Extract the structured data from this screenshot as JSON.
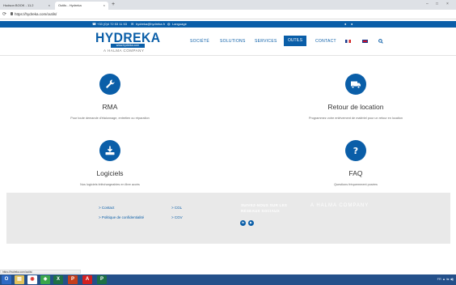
{
  "browser": {
    "tabs": [
      {
        "label": "Hudson BOOK - 11.2",
        "close": "×"
      },
      {
        "label": "Outils - Hydreka",
        "close": "×"
      }
    ],
    "new_tab": "+",
    "window_controls": [
      "–",
      "□",
      "×"
    ],
    "url": "https://hydreka.com/outils/"
  },
  "topbar": {
    "phone": "+33 (0)4 72 53 11 53",
    "email": "hydreka@hydreka.fr",
    "language": "Language"
  },
  "header": {
    "logo": "HYDREKA",
    "logo_web": "www.hydreka.com",
    "logo_sub": "A HALMA COMPANY",
    "nav": [
      "SOCIÉTÉ",
      "SOLUTIONS",
      "SERVICES",
      "OUTILS",
      "CONTACT"
    ]
  },
  "features": [
    {
      "title": "RMA",
      "desc": "Pour toute demande d'étalonnage, entretien ou réparation",
      "icon": "wrench-icon"
    },
    {
      "title": "Retour de location",
      "desc": "Programmez votre enlèvement de matériel pour un retour en location",
      "icon": "truck-icon"
    },
    {
      "title": "Logiciels",
      "desc": "Nos logiciels téléchargeables en libre accès",
      "icon": "download-icon"
    },
    {
      "title": "FAQ",
      "desc": "Questions fréquemment posées",
      "icon": "question-icon"
    }
  ],
  "footer": {
    "links_col1": [
      "> Contact",
      "> Politique de confidentialité"
    ],
    "links_col2": [
      "> CGL",
      "> CGV"
    ],
    "social_title": [
      "SUIVEZ-NOUS SUR LES",
      "RÉSEAUX SOCIAUX"
    ],
    "social_icons": [
      "in",
      "▶"
    ],
    "halma": "A HALMA COMPANY"
  },
  "status_text": "https://hydreka.com/outils/",
  "taskbar": {
    "tray": "FR ▲ ⇆ ◀)"
  },
  "colors": {
    "brand_blue": "#0a5ea8",
    "footer_bg": "#e9e9e9",
    "taskbar": "#24508a"
  }
}
